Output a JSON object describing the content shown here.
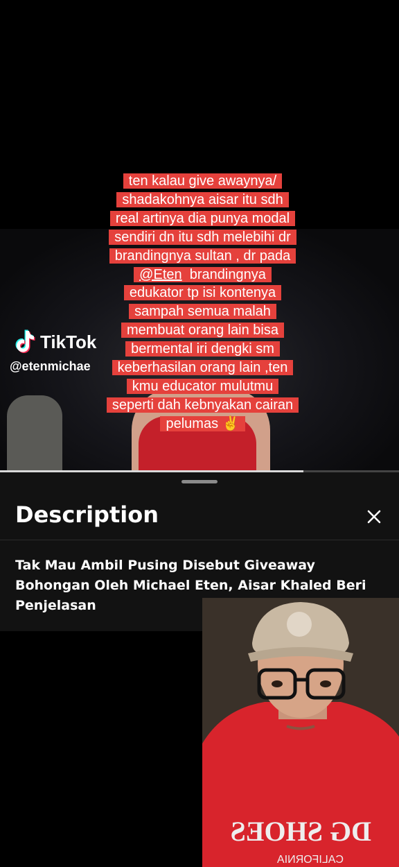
{
  "video": {
    "watermark_brand": "TikTok",
    "watermark_user": "@etenmichae",
    "caption_lines": [
      "ten kalau give awaynya/",
      "shadakohnya aisar itu sdh",
      "real artinya dia punya modal",
      "sendiri dn itu sdh melebihi dr",
      "brandingnya sultan , dr pada"
    ],
    "caption_mention": "@Eten",
    "caption_mention_rest": "  brandingnya",
    "caption_lines_after": [
      "edukator tp isi kontenya",
      "sampah semua malah",
      "membuat orang lain bisa",
      "bermental iri dengki sm",
      "keberhasilan orang lain ,ten",
      "kmu educator mulutmu",
      "seperti dah kebnyakan cairan",
      "pelumas ✌️"
    ],
    "caption_color": "#e5413c",
    "progress": 0.76
  },
  "sheet": {
    "title": "Description",
    "close_icon": "close-icon",
    "description": "Tak Mau Ambil Pusing Disebut Giveaway Bohongan Oleh Michael Eten, Aisar Khaled Beri Penjelasan"
  },
  "webcam": {
    "shirt_text_1": "DG SHOES",
    "shirt_text_2": "CALIFORNIA"
  }
}
